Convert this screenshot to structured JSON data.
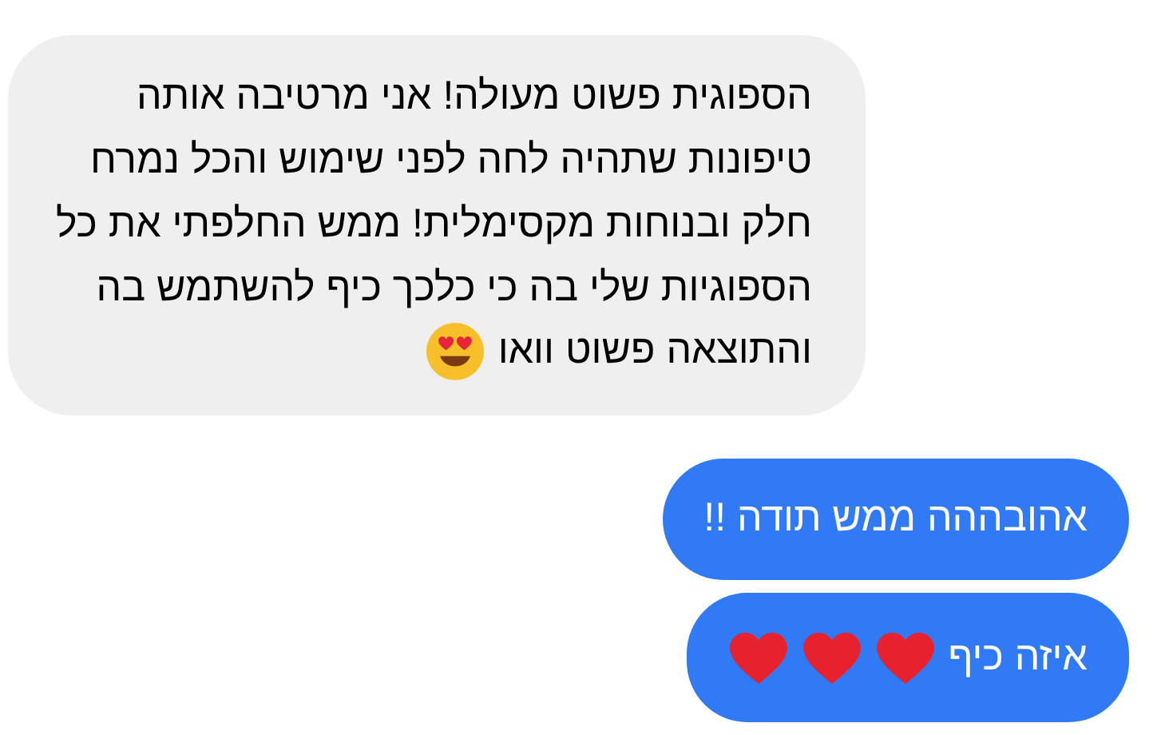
{
  "messages": [
    {
      "kind": "incoming",
      "text": "הספוגית פשוט מעולה! אני מרטיבה אותה\nטיפונות שתהיה לחה לפני שימוש והכל נמרח\nחלק ובנוחות מקסימלית! ממש החלפתי את כל\nהספוגיות שלי בה כי כלכך כיף להשתמש בה",
      "last_line": "והתוצאה פשוט וואו"
    },
    {
      "kind": "outgoing",
      "text": "אהובההה ממש תודה !!"
    },
    {
      "kind": "outgoing",
      "text": "איזה כיף"
    }
  ]
}
